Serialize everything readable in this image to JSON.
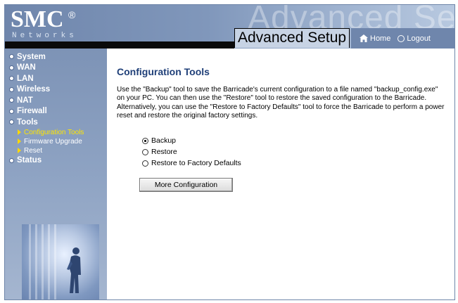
{
  "header": {
    "logo_main": "SMC",
    "logo_reg": "®",
    "logo_sub": "Networks",
    "watermark": "Advanced Setup",
    "title": "Advanced Setup",
    "home_label": "Home",
    "logout_label": "Logout"
  },
  "sidebar": {
    "items": [
      {
        "label": "System"
      },
      {
        "label": "WAN"
      },
      {
        "label": "LAN"
      },
      {
        "label": "Wireless"
      },
      {
        "label": "NAT"
      },
      {
        "label": "Firewall"
      },
      {
        "label": "Tools"
      }
    ],
    "tools_sub": [
      {
        "label": "Configuration Tools"
      },
      {
        "label": "Firmware Upgrade"
      },
      {
        "label": "Reset"
      }
    ],
    "status_label": "Status"
  },
  "main": {
    "title": "Configuration Tools",
    "description": "Use the \"Backup\" tool to save the Barricade's current configuration to a file named \"backup_config.exe\" on your PC. You can then use the \"Restore\" tool to restore the saved configuration to the Barricade.  Alternatively, you can use the \"Restore to Factory Defaults\" tool to force the Barricade to perform a power reset and restore the original factory settings.",
    "options": [
      {
        "label": "Backup",
        "selected": true
      },
      {
        "label": "Restore",
        "selected": false
      },
      {
        "label": "Restore to Factory Defaults",
        "selected": false
      }
    ],
    "button_label": "More Configuration"
  },
  "colors": {
    "title_blue": "#1f3f78",
    "sidebar_active": "#ffe600",
    "header_blue": "#6f86ac"
  }
}
